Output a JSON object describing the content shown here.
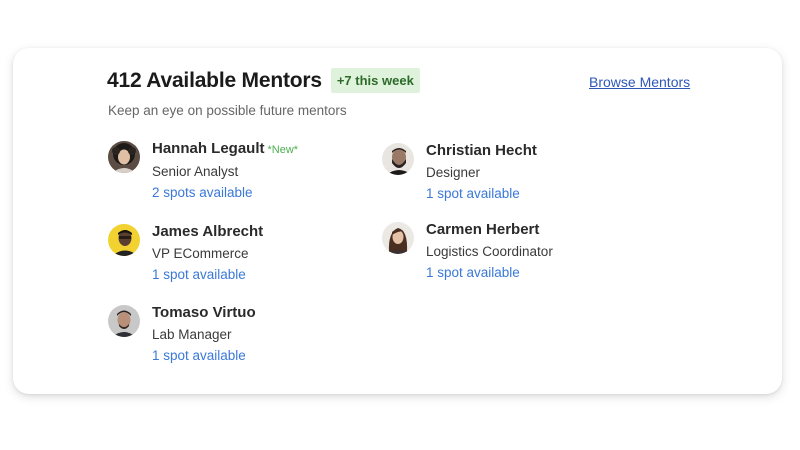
{
  "header": {
    "count_title": "412 Available Mentors",
    "weekly_badge": "+7 this week",
    "browse_link": "Browse Mentors",
    "subtitle": "Keep an eye on possible future mentors"
  },
  "mentors": [
    {
      "name": "Hannah Legault",
      "new_tag": "*New*",
      "role": "Senior Analyst",
      "spots": "2 spots available",
      "avatar": "woman-curly-hair-avatar"
    },
    {
      "name": "Christian Hecht",
      "role": "Designer",
      "spots": "1 spot available",
      "avatar": "bearded-man-avatar"
    },
    {
      "name": "James Albrecht",
      "role": "VP ECommerce",
      "spots": "1 spot available",
      "avatar": "man-yellow-background-avatar"
    },
    {
      "name": "Carmen Herbert",
      "role": "Logistics Coordinator",
      "spots": "1 spot available",
      "avatar": "woman-long-hair-avatar"
    },
    {
      "name": "Tomaso Virtuo",
      "role": "Lab Manager",
      "spots": "1 spot available",
      "avatar": "man-dark-hair-avatar"
    }
  ],
  "colors": {
    "badge_bg": "#dff2dc",
    "badge_text": "#2e6b2a",
    "link": "#2d58b8",
    "spots": "#3a78d8",
    "new_tag": "#4caf50"
  }
}
